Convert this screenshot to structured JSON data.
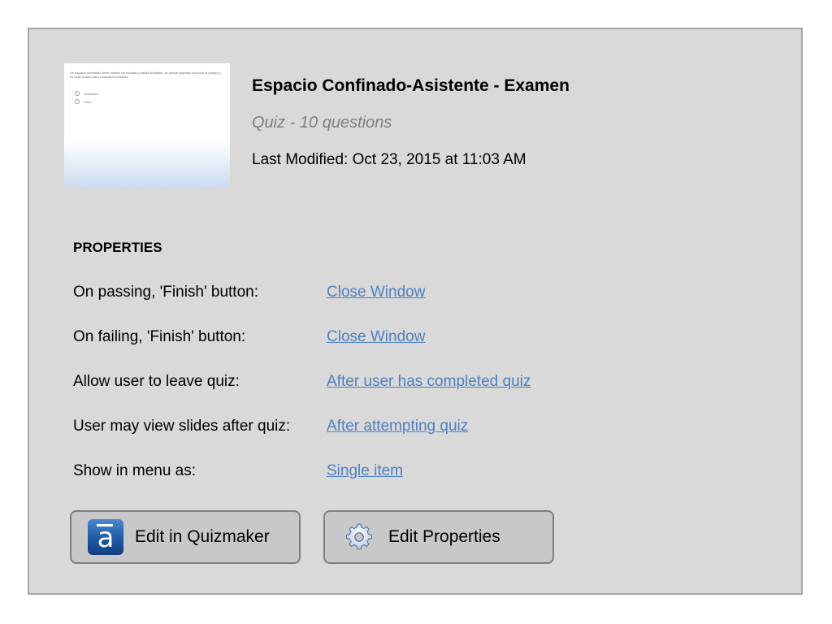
{
  "thumbnail": {
    "question": "Un espacio confinado tiene medios de entrada o salida limitados, se puede ingresar con todo el cuerpo y no está creado para ocupación continua.",
    "options": [
      "Verdadero",
      "Falso"
    ]
  },
  "header": {
    "title": "Espacio Confinado-Asistente - Examen",
    "subtitle": "Quiz - 10 questions",
    "last_modified": "Last Modified: Oct 23, 2015 at 11:03 AM"
  },
  "properties": {
    "heading": "PROPERTIES",
    "rows": [
      {
        "label": "On passing, 'Finish' button:",
        "value": "Close Window"
      },
      {
        "label": "On failing, 'Finish' button:",
        "value": "Close Window"
      },
      {
        "label": "Allow user to leave quiz:",
        "value": "After user has completed quiz"
      },
      {
        "label": "User may view slides after quiz:",
        "value": "After attempting quiz"
      },
      {
        "label": "Show in menu as:",
        "value": "Single item"
      }
    ]
  },
  "buttons": {
    "edit_quizmaker": {
      "label": "Edit in Quizmaker",
      "icon": "quizmaker-app-icon"
    },
    "edit_properties": {
      "label": "Edit Properties",
      "icon": "gear-icon"
    }
  },
  "colors": {
    "panel_bg": "#d9d9d9",
    "link": "#4f81bd",
    "button_bg": "#c8c8c8"
  }
}
